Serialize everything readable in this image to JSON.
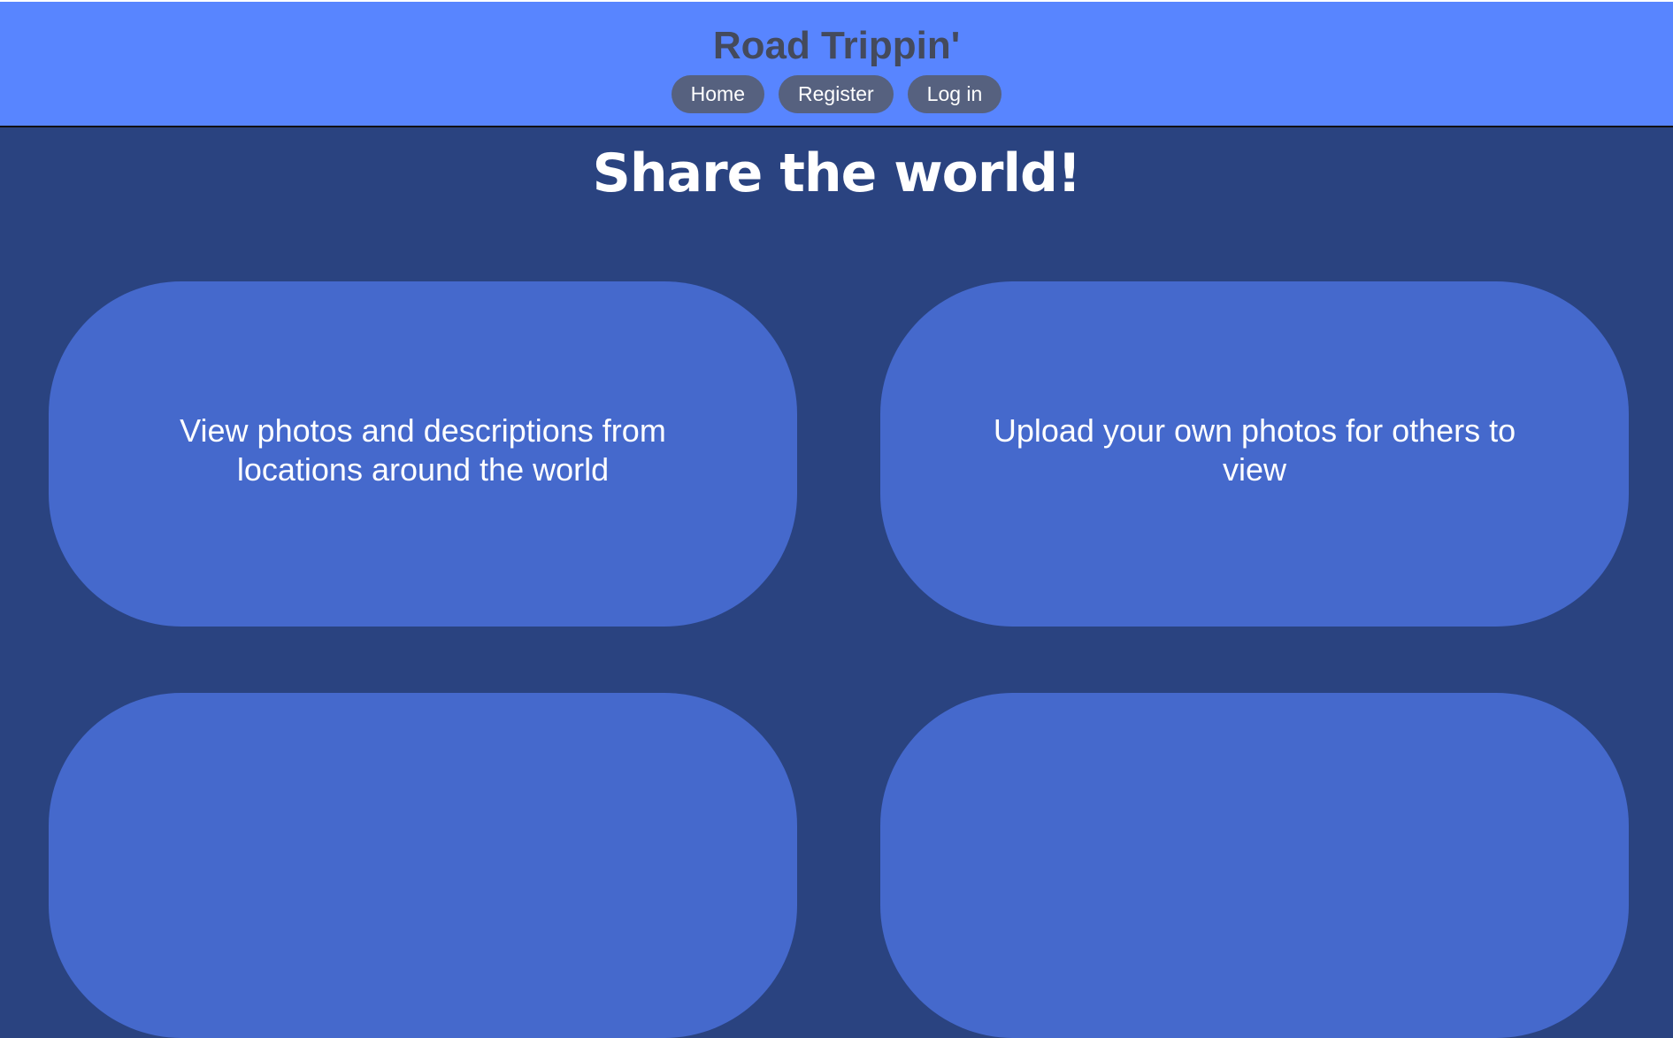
{
  "header": {
    "title": "Road Trippin'",
    "nav": [
      {
        "label": "Home"
      },
      {
        "label": "Register"
      },
      {
        "label": "Log in"
      }
    ]
  },
  "main": {
    "heading": "Share the world!",
    "cards": [
      {
        "text": "View photos and descriptions from locations around the world"
      },
      {
        "text": "Upload your own photos for others to view"
      }
    ]
  },
  "colors": {
    "header_bg": "#5885ff",
    "page_bg": "#2a4380",
    "card_bg": "#4569cc",
    "nav_button_bg": "#56617f",
    "title_text": "#444a5c"
  }
}
